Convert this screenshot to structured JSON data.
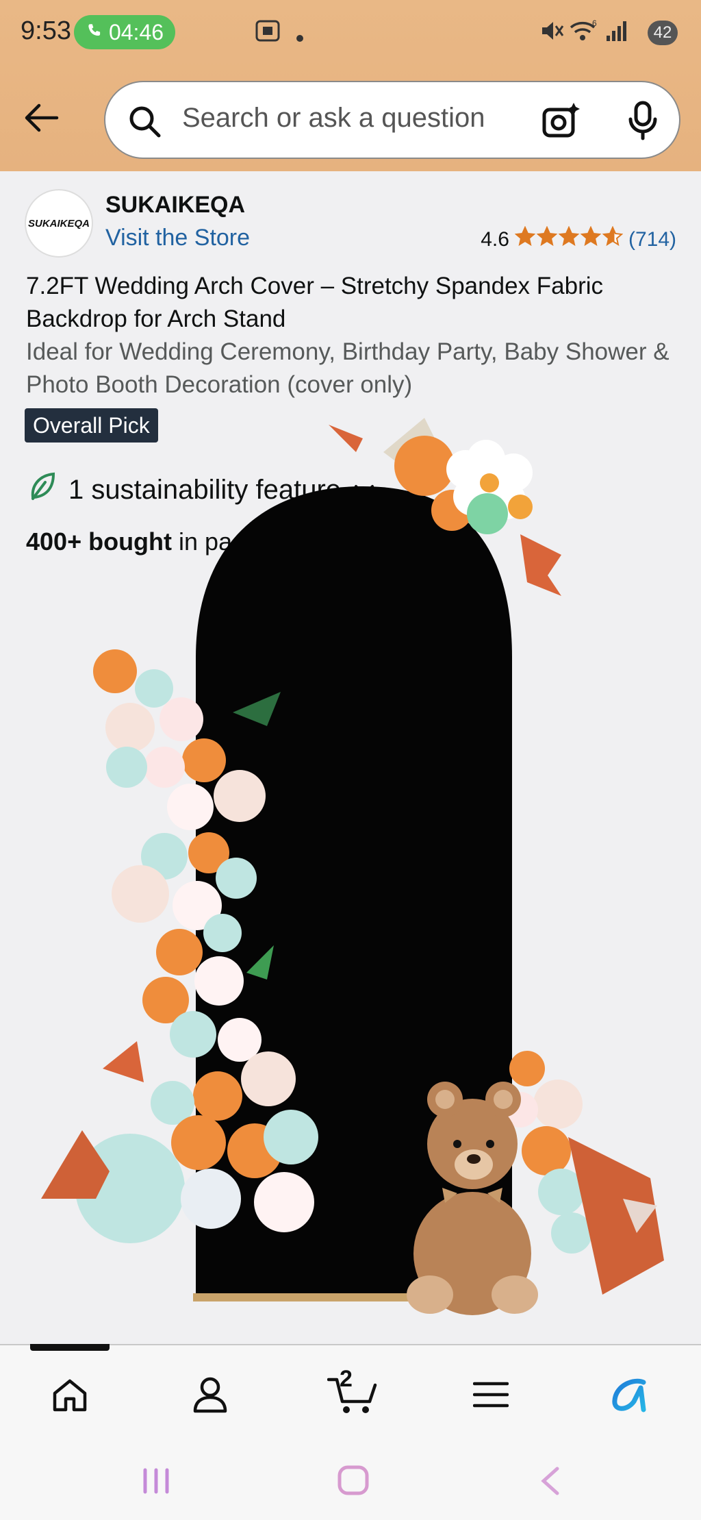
{
  "status_bar": {
    "time": "9:53",
    "call_timer": "04:46",
    "signal_badge": "6",
    "battery": "42"
  },
  "search": {
    "placeholder": "Search or ask a question"
  },
  "store": {
    "brand": "SUKAIKEQA",
    "logo_text": "SUKAIKEQA",
    "visit_link": "Visit the Store"
  },
  "rating": {
    "value": "4.6",
    "stars_display": "★★★★☆",
    "count": "(714)"
  },
  "product": {
    "title": "7.2FT Wedding Arch Cover – Stretchy Spandex Fabric Backdrop for Arch Stand",
    "subtitle": "Ideal for Wedding Ceremony, Birthday Party, Baby Shower & Photo Booth Decoration (cover only)",
    "badge": "Overall Pick",
    "sustainability": "1 sustainability feature",
    "bought_bold": "400+ bought",
    "bought_rest": " in past month"
  },
  "bottom_nav": {
    "cart_count": "2",
    "active": "home"
  },
  "colors": {
    "header_bg": "#e6b27f",
    "link": "#2162a1",
    "star": "#de7921",
    "badge_bg": "#232f3e",
    "leaf": "#2e8b57"
  }
}
